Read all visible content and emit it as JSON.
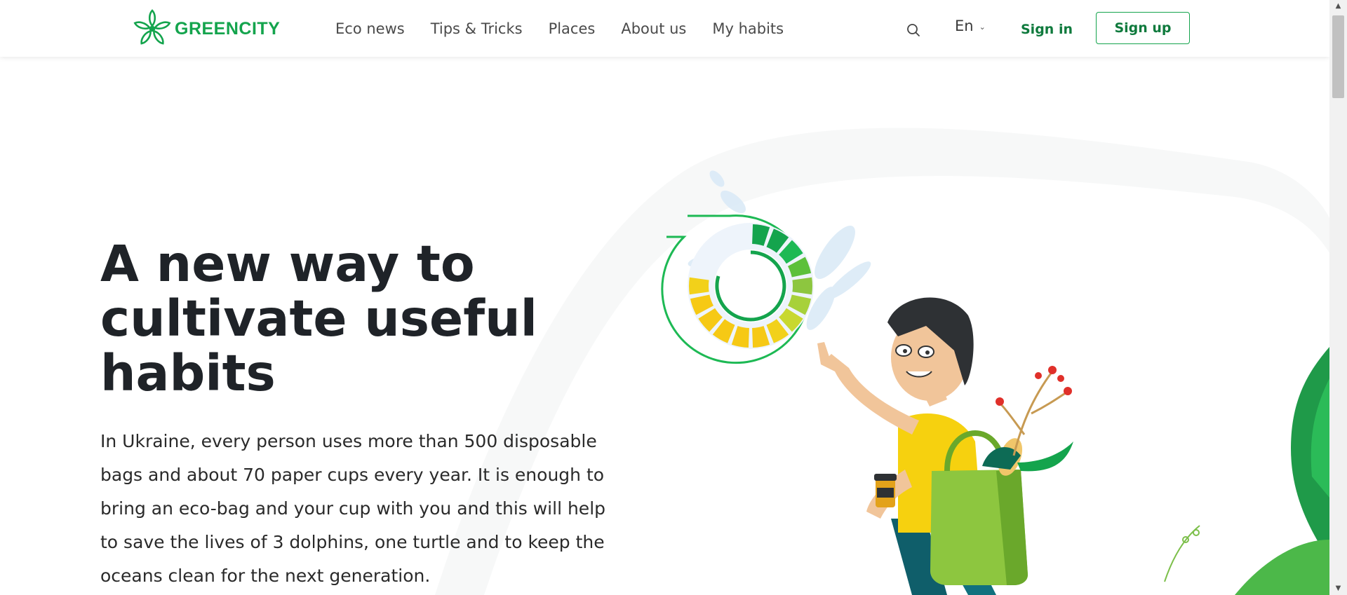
{
  "header": {
    "logo_text": "GREENCITY",
    "nav": [
      {
        "label": "Eco news"
      },
      {
        "label": "Tips & Tricks"
      },
      {
        "label": "Places"
      },
      {
        "label": "About us"
      },
      {
        "label": "My habits"
      }
    ],
    "search_icon": "search-icon",
    "language": "En",
    "sign_in": "Sign in",
    "sign_up": "Sign up"
  },
  "hero": {
    "title": "A new way to cultivate useful habits",
    "text": "In Ukraine, every person uses more than 500 disposable bags and about 70 paper cups every year. It is enough to bring an eco-bag and your cup with you and this will help to save the lives of 3 dolphins, one turtle and to keep the oceans clean for the next generation."
  },
  "colors": {
    "brand_green": "#14a44d",
    "dark_green": "#0f7a3d",
    "heading": "#1f2328"
  }
}
